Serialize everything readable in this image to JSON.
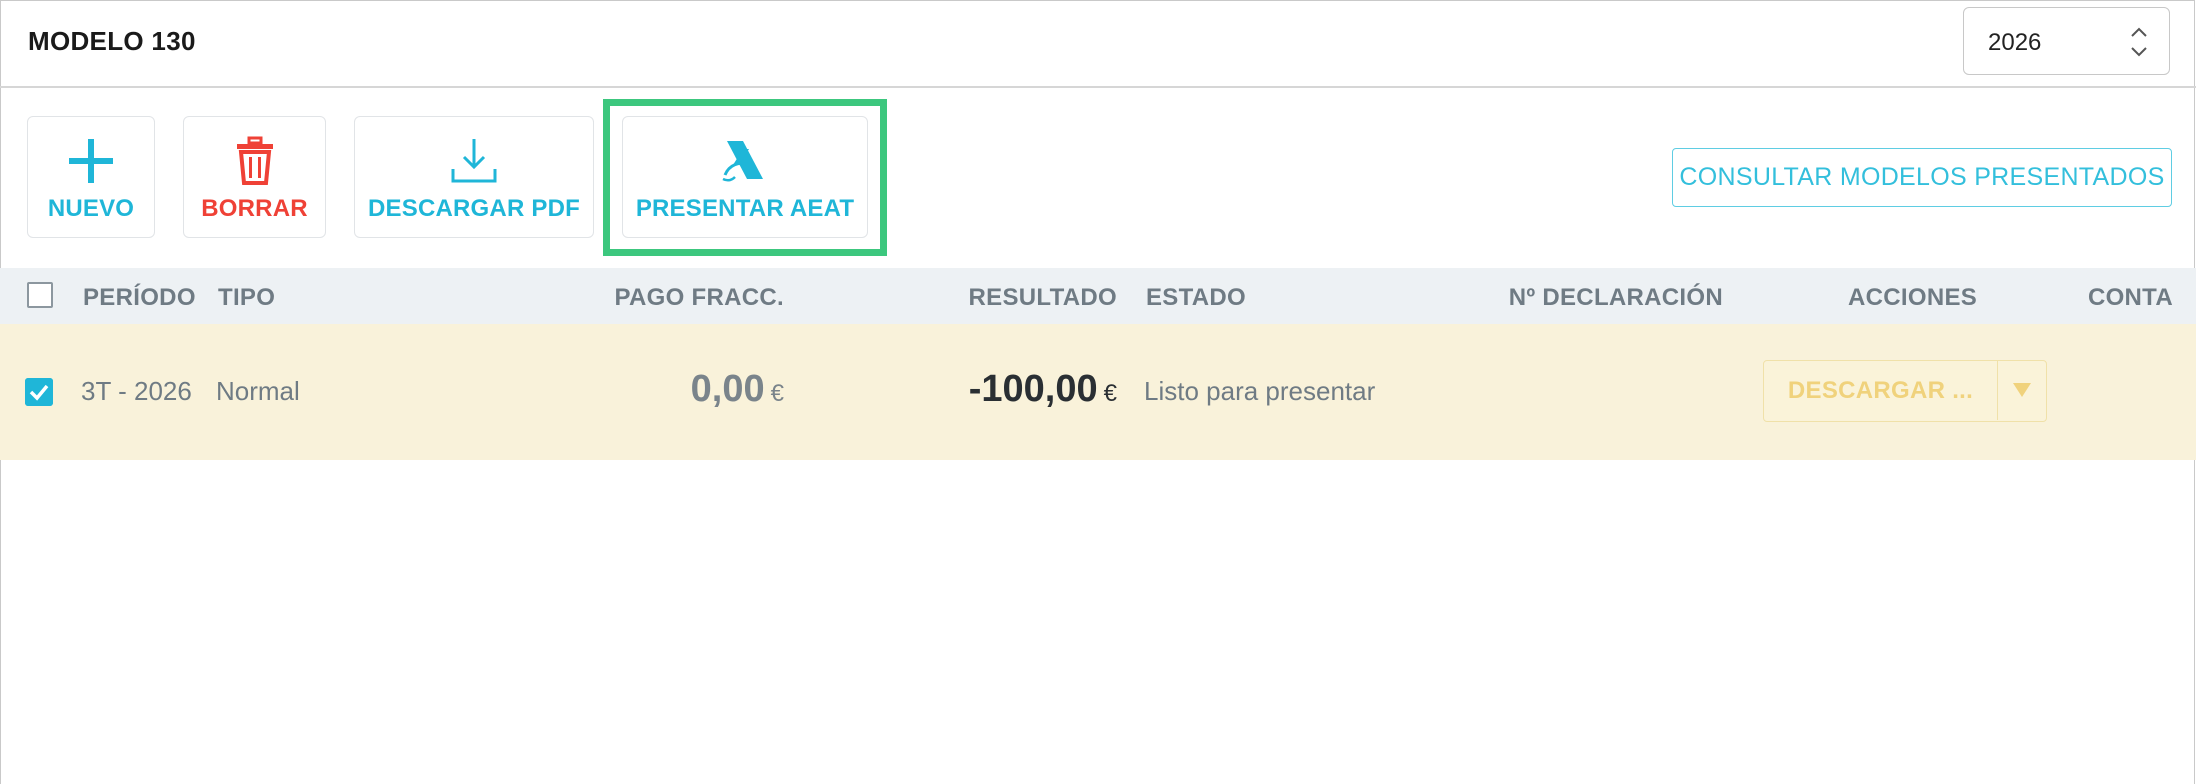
{
  "header": {
    "title": "MODELO 130",
    "year_value": "2026"
  },
  "toolbar": {
    "nuevo_label": "NUEVO",
    "borrar_label": "BORRAR",
    "descargar_pdf_label": "DESCARGAR PDF",
    "presentar_aeat_label": "PRESENTAR AEAT",
    "consultar_label": "CONSULTAR MODELOS PRESENTADOS"
  },
  "table": {
    "columns": {
      "periodo": "PERÍODO",
      "tipo": "TIPO",
      "pago_fracc": "PAGO FRACC.",
      "resultado": "RESULTADO",
      "estado": "ESTADO",
      "n_declaracion": "Nº DECLARACIÓN",
      "acciones": "ACCIONES",
      "conta": "CONTA"
    },
    "rows": [
      {
        "checked": true,
        "periodo": "3T - 2026",
        "tipo": "Normal",
        "pago_fracc": "0,00",
        "pago_fracc_currency": "€",
        "resultado": "-100,00",
        "resultado_currency": "€",
        "estado": "Listo para presentar",
        "n_declaracion": "",
        "accion_label": "DESCARGAR ..."
      }
    ]
  },
  "colors": {
    "accent": "#1fb6d8",
    "danger": "#ef4136",
    "highlight": "#3cc77e",
    "row_selected": "#f9f2da",
    "header_bg": "#edf1f4"
  },
  "icons": {
    "nuevo": "plus-icon",
    "borrar": "trash-icon",
    "descargar_pdf": "download-icon",
    "presentar_aeat": "aeat-logo-icon",
    "acciones_caret": "caret-down-icon",
    "year_spinner": "chevron-up-down-icon"
  }
}
